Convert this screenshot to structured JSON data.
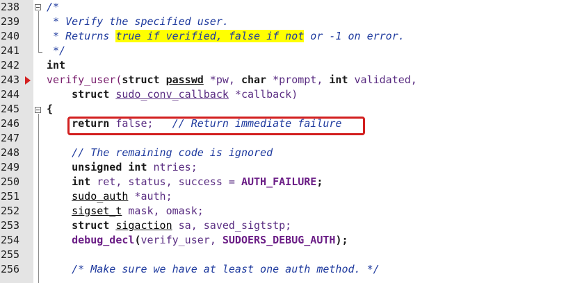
{
  "line_numbers": [
    "238",
    "239",
    "240",
    "241",
    "242",
    "243",
    "244",
    "245",
    "246",
    "247",
    "248",
    "249",
    "250",
    "251",
    "252",
    "253",
    "254",
    "255",
    "256"
  ],
  "code": {
    "l238": "/*",
    "l239": " * Verify the specified user.",
    "l240a": " * Returns ",
    "l240b": "true if verified, false if not",
    "l240c": " or -1 on error.",
    "l241": " */",
    "l242": "int",
    "l243_fn": "verify_user(",
    "l243_struct": "struct",
    "l243_sp1": " ",
    "l243_passwd": "passwd",
    "l243_pw": " *pw, ",
    "l243_char": "char",
    "l243_prompt": " *prompt, ",
    "l243_int": "int",
    "l243_validated": " validated,",
    "l244_indent": "    ",
    "l244_struct": "struct",
    "l244_sp": " ",
    "l244_type": "sudo_conv_callback",
    "l244_rest": " *callback)",
    "l245": "{",
    "l246_indent": "    ",
    "l246_return": "return",
    "l246_sp": " ",
    "l246_false": "false",
    "l246_semi": ";   ",
    "l246_comment": "// Return immediate failure",
    "l248_indent": "    ",
    "l248_comment": "// The remaining code is ignored",
    "l249_indent": "    ",
    "l249_unsigned": "unsigned int",
    "l249_rest": " ntries;",
    "l250_indent": "    ",
    "l250_int": "int",
    "l250_vars": " ret, status, success = ",
    "l250_const": "AUTH_FAILURE",
    "l250_semi": ";",
    "l251_indent": "    ",
    "l251_type": "sudo_auth",
    "l251_rest": " *auth;",
    "l252_indent": "    ",
    "l252_type": "sigset_t",
    "l252_rest": " mask, omask;",
    "l253_indent": "    ",
    "l253_struct": "struct",
    "l253_sp": " ",
    "l253_type": "sigaction",
    "l253_rest": " sa, saved_sigtstp;",
    "l254_indent": "    ",
    "l254_fn": "debug_decl",
    "l254_open": "(",
    "l254_arg1": "verify_user",
    "l254_comma": ", ",
    "l254_arg2": "SUDOERS_DEBUG_AUTH",
    "l254_close": ");",
    "l256_indent": "    ",
    "l256_comment": "/* Make sure we have at least one auth method. */"
  },
  "icons": {
    "breakpoint": "current-line-arrow-icon",
    "fold": "fold-toggle-icon"
  },
  "colors": {
    "highlight": "#ffff00",
    "annotation_box": "#d21f1f",
    "breakpoint_arrow": "#d42020"
  }
}
